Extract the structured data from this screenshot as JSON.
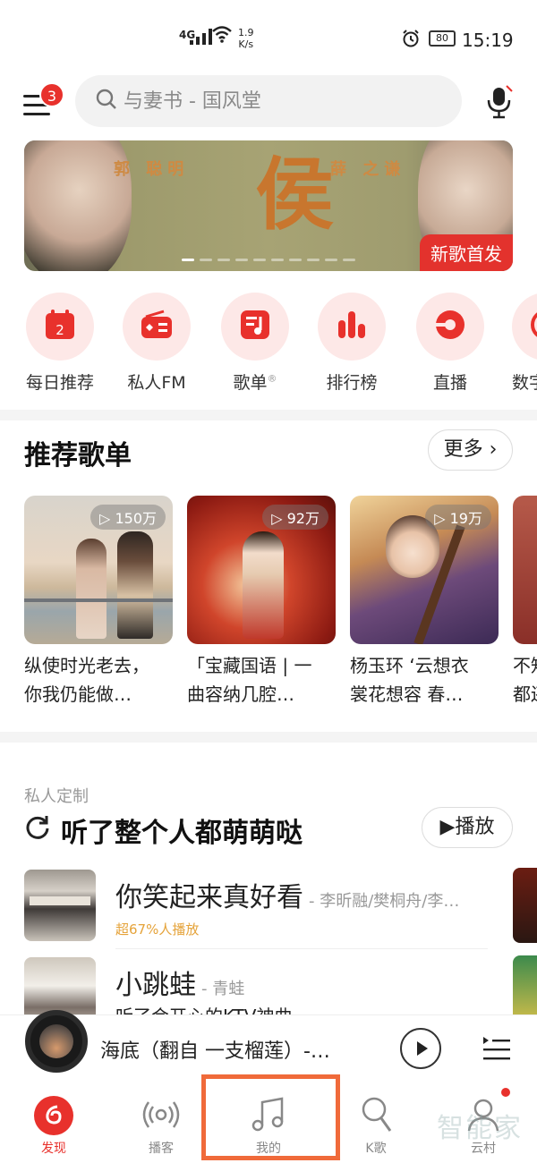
{
  "status_bar": {
    "network": "4G",
    "speed_value": "1.9",
    "speed_unit": "K/s",
    "battery": "80",
    "time": "15:19"
  },
  "header": {
    "menu_badge": "3",
    "search_placeholder": "与妻书 - 国风堂"
  },
  "banner": {
    "name_left": "郭 聪明",
    "name_right": "薛 之谦",
    "tag": "新歌首发",
    "dots_total": 10,
    "active_dot": 0
  },
  "quick_nav": [
    {
      "label": "每日推荐",
      "icon": "calendar-icon",
      "day": "2"
    },
    {
      "label": "私人FM",
      "icon": "radio-icon"
    },
    {
      "label": "歌单",
      "icon": "playlist-icon",
      "sup": "®"
    },
    {
      "label": "排行榜",
      "icon": "chart-icon"
    },
    {
      "label": "直播",
      "icon": "live-icon"
    },
    {
      "label": "数字",
      "icon": "digital-icon"
    }
  ],
  "recommend": {
    "title": "推荐歌单",
    "more": "更多",
    "playlists": [
      {
        "count": "150万",
        "line1": "纵使时光老去，",
        "line2": "你我仍能做…"
      },
      {
        "count": "92万",
        "line1": "「宝藏国语 | 一",
        "line2": "曲容纳几腔…"
      },
      {
        "count": "19万",
        "line1": "杨玉环 ‘云想衣",
        "line2": "裳花想容 春…"
      },
      {
        "count": "",
        "line1": "不知",
        "line2": "都还"
      }
    ]
  },
  "custom": {
    "sub_label": "私人定制",
    "title": "听了整个人都萌萌哒",
    "play": "播放",
    "songs": [
      {
        "title": "你笑起来真好看",
        "artist": "- 李昕融/樊桐舟/李…",
        "badge": "超67%人播放"
      },
      {
        "title": "小跳蛙",
        "artist": "- 青蛙",
        "badge": "听了会开心的KTV神曲"
      }
    ]
  },
  "player": {
    "title": "海底（翻自 一支榴莲）-…"
  },
  "tabs": [
    {
      "label": "发现",
      "icon": "discover-icon"
    },
    {
      "label": "播客",
      "icon": "podcast-icon"
    },
    {
      "label": "我的",
      "icon": "music-note-icon"
    },
    {
      "label": "K歌",
      "icon": "karaoke-mic-icon"
    },
    {
      "label": "云村",
      "icon": "community-icon"
    }
  ],
  "watermark": "智能家",
  "colors": {
    "accent": "#e8312c",
    "highlight_box": "#f06a3a",
    "badge_gold": "#e5a33a"
  }
}
